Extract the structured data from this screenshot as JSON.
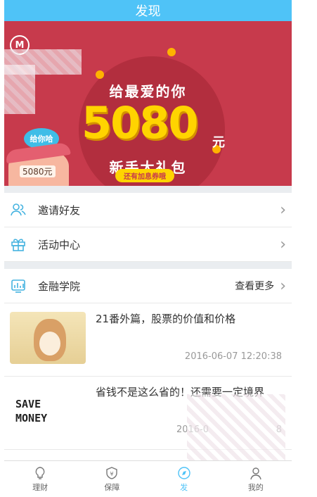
{
  "header": {
    "title": "发现"
  },
  "banner": {
    "line1": "给最爱的你",
    "amount": "5080",
    "unit": "元",
    "line2": "新手大礼包",
    "pill": "还有加息券哦",
    "bubble": "给你哈",
    "figure_label": "5080元",
    "accent": "#c73a4c",
    "gold": "#ffd400"
  },
  "menu": [
    {
      "label": "邀请好友",
      "icon": "users-icon"
    },
    {
      "label": "活动中心",
      "icon": "gift-icon"
    }
  ],
  "academy": {
    "label": "金融学院",
    "more": "查看更多",
    "icon": "chart-icon"
  },
  "articles": [
    {
      "title": "21番外篇，股票的价值和价格",
      "date": "2016-06-07 12:20:38"
    },
    {
      "title": "省钱不是这么省的！还需要一定境界",
      "date": "2016-0",
      "date_tail": "8"
    }
  ],
  "thumb_money": {
    "line1": "SAVE",
    "line2": "MONEY"
  },
  "tabs": [
    {
      "label": "理财",
      "icon": "bulb-icon",
      "glyph": "💡"
    },
    {
      "label": "保障",
      "icon": "shield-icon",
      "glyph": "⛉"
    },
    {
      "label": "发",
      "icon": "compass-icon",
      "glyph": "◎"
    },
    {
      "label": "我的",
      "icon": "user-icon",
      "glyph": "☺"
    }
  ],
  "colors": {
    "primary": "#4fc3f7",
    "divider": "#eaedf0"
  }
}
